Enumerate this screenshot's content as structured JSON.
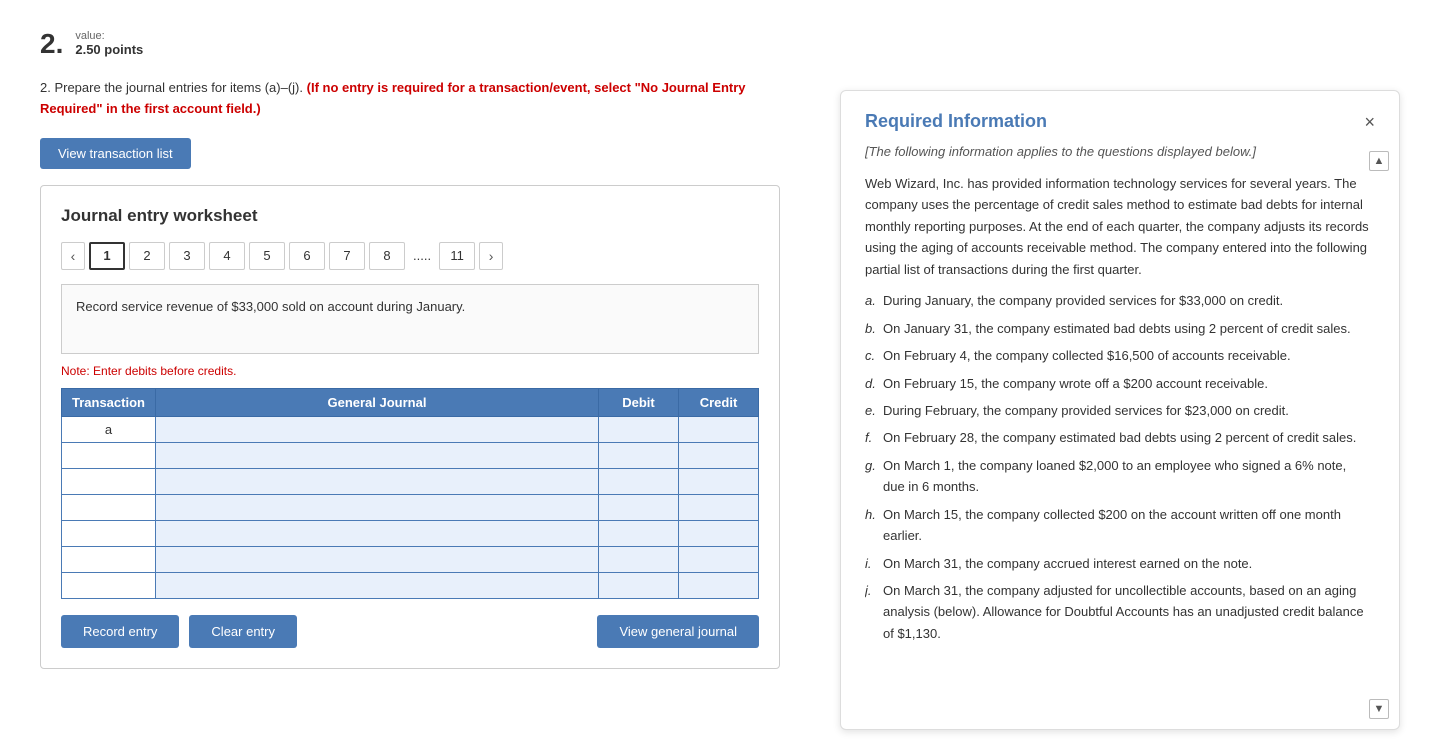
{
  "question": {
    "number": "2.",
    "value_label": "value:",
    "points": "2.50 points",
    "body_prefix": "2.  Prepare the journal entries for items (a)–(j).",
    "body_highlight": "(If no entry is required for a transaction/event, select \"No Journal Entry Required\" in the first account field.)",
    "view_transactions_label": "View transaction list",
    "worksheet_title": "Journal entry worksheet",
    "tabs": [
      "1",
      "2",
      "3",
      "4",
      "5",
      "6",
      "7",
      "8",
      ".....",
      "11"
    ],
    "active_tab": "1",
    "description": "Record service revenue of $33,000 sold on account during January.",
    "note": "Note: Enter debits before credits.",
    "table_headers": [
      "Transaction",
      "General Journal",
      "Debit",
      "Credit"
    ],
    "table_first_transaction": "a",
    "record_entry_label": "Record entry",
    "clear_entry_label": "Clear entry",
    "view_general_journal_label": "View general journal"
  },
  "info_panel": {
    "title": "Required Information",
    "close_icon": "×",
    "scroll_up_icon": "▲",
    "scroll_down_icon": "▼",
    "subtitle": "[The following information applies to the questions displayed below.]",
    "intro": "Web Wizard, Inc. has provided information technology services for several years. The company uses the percentage of credit sales method to estimate bad debts for internal monthly reporting purposes. At the end of each quarter, the company adjusts its records using the aging of accounts receivable method. The company entered into the following partial list of transactions during the first quarter.",
    "items": [
      {
        "label": "a.",
        "text": "During January, the company provided services for $33,000 on credit."
      },
      {
        "label": "b.",
        "text": "On January 31, the company estimated bad debts using 2 percent of credit sales."
      },
      {
        "label": "c.",
        "text": "On February 4, the company collected $16,500 of accounts receivable."
      },
      {
        "label": "d.",
        "text": "On February 15, the company wrote off a $200 account receivable."
      },
      {
        "label": "e.",
        "text": "During February, the company provided services for $23,000 on credit."
      },
      {
        "label": "f.",
        "text": "On February 28, the company estimated bad debts using 2 percent of credit sales."
      },
      {
        "label": "g.",
        "text": "On March 1, the company loaned $2,000 to an employee who signed a 6% note, due in 6 months."
      },
      {
        "label": "h.",
        "text": "On March 15, the company collected $200 on the account written off one month earlier."
      },
      {
        "label": "i.",
        "text": "On March 31, the company accrued interest earned on the note."
      },
      {
        "label": "j.",
        "text": "On March 31, the company adjusted for uncollectible accounts, based on an aging analysis (below). Allowance for Doubtful Accounts has an unadjusted credit balance of $1,130."
      }
    ]
  }
}
